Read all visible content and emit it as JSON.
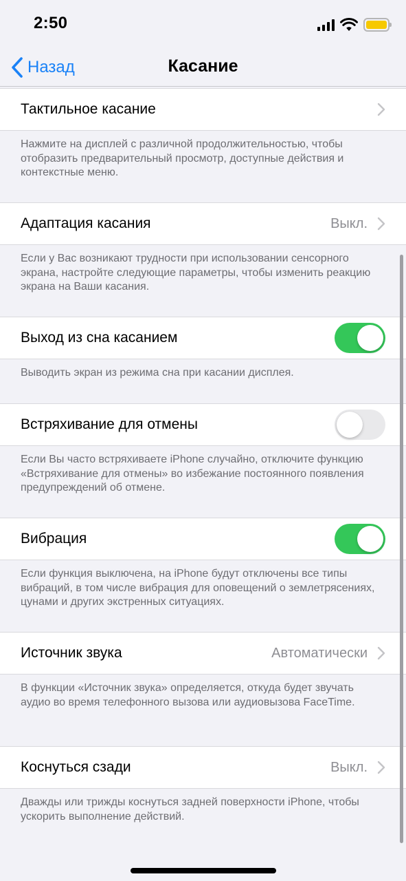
{
  "status_bar": {
    "time": "2:50",
    "battery_color": "#f7c900"
  },
  "nav": {
    "back_label": "Назад",
    "title": "Касание"
  },
  "sections": [
    {
      "label": "Тактильное касание",
      "value": "",
      "control": "chevron",
      "footer": "Нажмите на дисплей с различной продолжительностью, чтобы отобразить предварительный просмотр, доступные действия и контекстные меню."
    },
    {
      "label": "Адаптация касания",
      "value": "Выкл.",
      "control": "chevron",
      "footer": "Если у Вас возникают трудности при использовании сенсорного экрана, настройте следующие параметры, чтобы изменить реакцию экрана на Ваши касания."
    },
    {
      "label": "Выход из сна касанием",
      "value": "",
      "control": "toggle",
      "on": true,
      "footer": "Выводить экран из режима сна при касании дисплея."
    },
    {
      "label": "Встряхивание для отмены",
      "value": "",
      "control": "toggle",
      "on": false,
      "footer": "Если Вы часто встряхиваете iPhone случайно, отключите функцию «Встряхивание для отмены» во избежание постоянного появления предупреждений об отмене."
    },
    {
      "label": "Вибрация",
      "value": "",
      "control": "toggle",
      "on": true,
      "footer": "Если функция выключена, на iPhone будут отключены все типы вибраций, в том числе вибрация для оповещений о землетрясениях, цунами и других экстренных ситуациях."
    },
    {
      "label": "Источник звука",
      "value": "Автоматически",
      "control": "chevron",
      "footer": "В функции «Источник звука» определяется, откуда будет звучать аудио во время телефонного вызова или аудиовызова FaceTime."
    },
    {
      "label": "Коснуться сзади",
      "value": "Выкл.",
      "control": "chevron",
      "footer": "Дважды или трижды коснуться задней поверхности iPhone, чтобы ускорить выполнение действий."
    }
  ],
  "colors": {
    "accent": "#1a82f7",
    "toggle_on": "#34c759",
    "toggle_off": "#e9e9eb"
  }
}
